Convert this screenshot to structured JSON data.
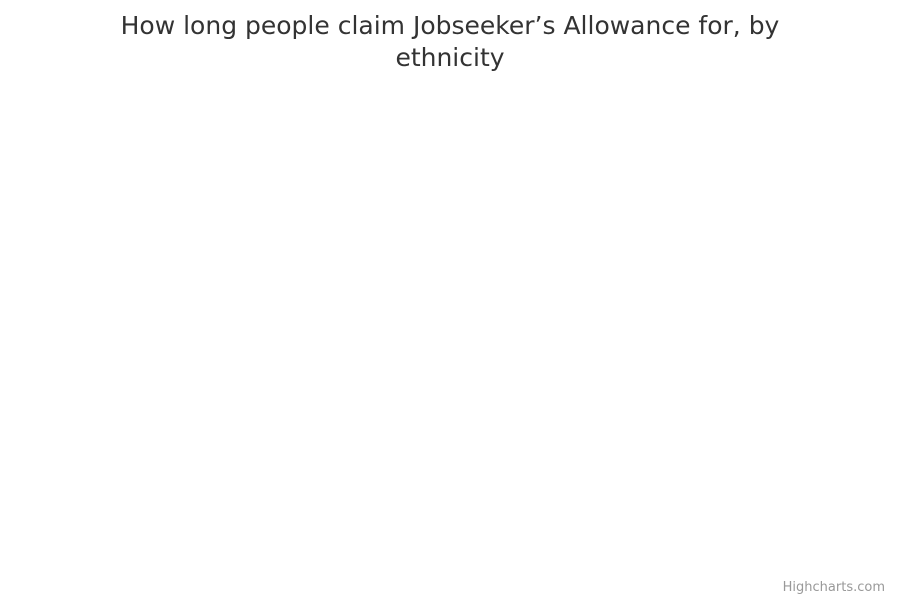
{
  "chart_data": {
    "type": "bar",
    "title": "How long people claim Jobseeker’s Allowance for, by ethnicity",
    "categories": [],
    "series": []
  },
  "credits": {
    "text": "Highcharts.com"
  }
}
